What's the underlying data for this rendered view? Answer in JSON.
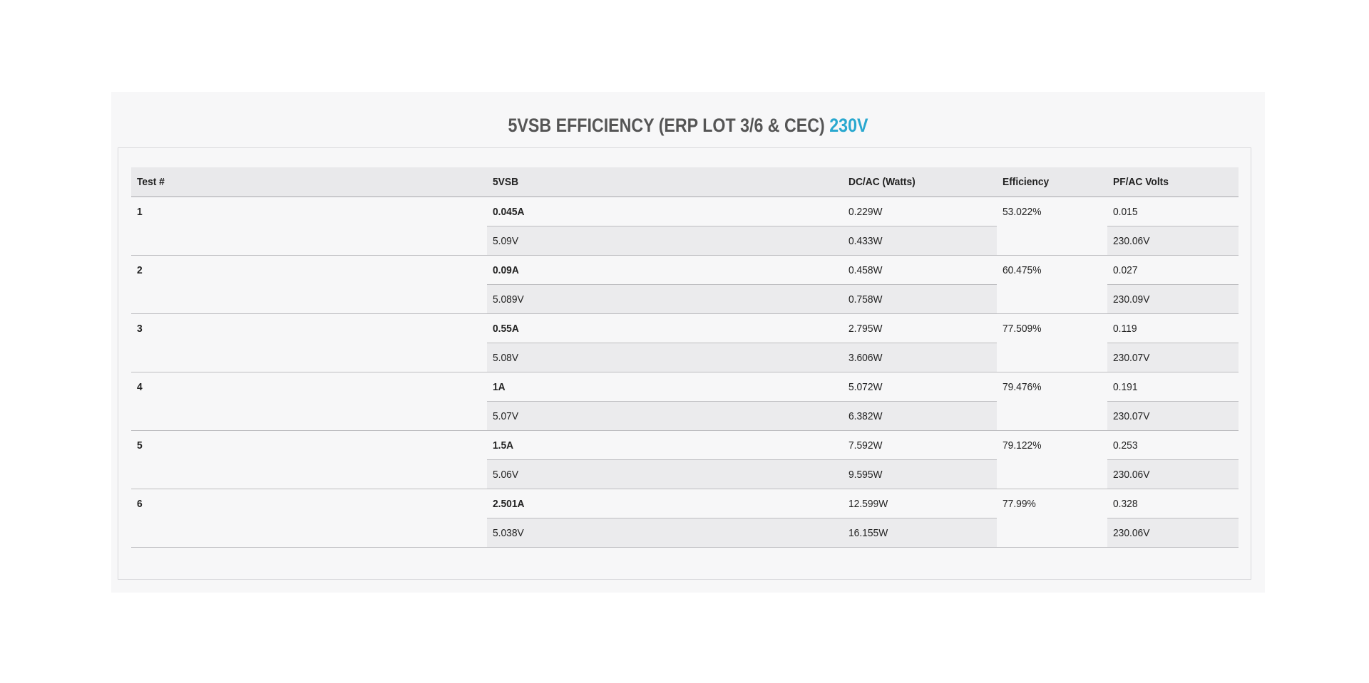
{
  "title": {
    "main": "5VSB EFFICIENCY (ERP LOT 3/6 & CEC)",
    "accent": "230V"
  },
  "colors": {
    "accent": "#29a8cf",
    "title": "#555555",
    "header_bg": "#e9e9eb",
    "row_shade": "#ebebed"
  },
  "chart_data": {
    "type": "table",
    "columns": [
      "Test #",
      "5VSB",
      "DC/AC (Watts)",
      "Efficiency",
      "PF/AC Volts"
    ],
    "rows": [
      {
        "test": "1",
        "amps": "0.045A",
        "volts": "5.09V",
        "dc_watts": "0.229W",
        "ac_watts": "0.433W",
        "efficiency": "53.022%",
        "pf": "0.015",
        "ac_volts": "230.06V"
      },
      {
        "test": "2",
        "amps": "0.09A",
        "volts": "5.089V",
        "dc_watts": "0.458W",
        "ac_watts": "0.758W",
        "efficiency": "60.475%",
        "pf": "0.027",
        "ac_volts": "230.09V"
      },
      {
        "test": "3",
        "amps": "0.55A",
        "volts": "5.08V",
        "dc_watts": "2.795W",
        "ac_watts": "3.606W",
        "efficiency": "77.509%",
        "pf": "0.119",
        "ac_volts": "230.07V"
      },
      {
        "test": "4",
        "amps": "1A",
        "volts": "5.07V",
        "dc_watts": "5.072W",
        "ac_watts": "6.382W",
        "efficiency": "79.476%",
        "pf": "0.191",
        "ac_volts": "230.07V"
      },
      {
        "test": "5",
        "amps": "1.5A",
        "volts": "5.06V",
        "dc_watts": "7.592W",
        "ac_watts": "9.595W",
        "efficiency": "79.122%",
        "pf": "0.253",
        "ac_volts": "230.06V"
      },
      {
        "test": "6",
        "amps": "2.501A",
        "volts": "5.038V",
        "dc_watts": "12.599W",
        "ac_watts": "16.155W",
        "efficiency": "77.99%",
        "pf": "0.328",
        "ac_volts": "230.06V"
      }
    ]
  }
}
